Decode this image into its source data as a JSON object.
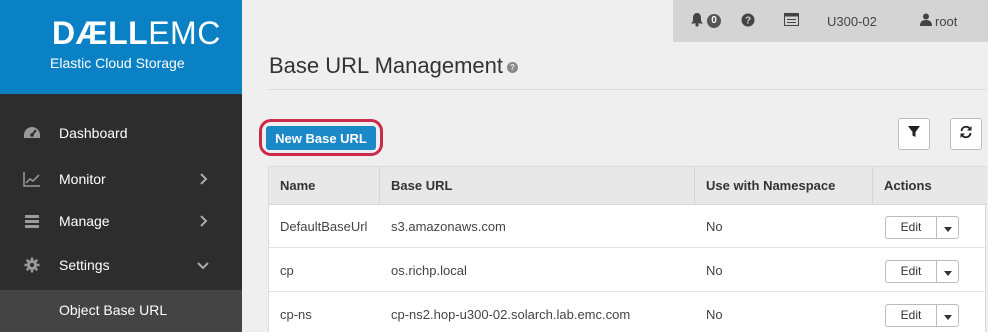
{
  "brand": {
    "logo_dell": "DÆLL",
    "logo_emc": "EMC",
    "product": "Elastic Cloud Storage"
  },
  "sidebar": {
    "items": [
      {
        "label": "Dashboard",
        "icon": "dashboard-icon"
      },
      {
        "label": "Monitor",
        "icon": "chart-line-icon",
        "chevron": "right"
      },
      {
        "label": "Manage",
        "icon": "server-icon",
        "chevron": "right"
      },
      {
        "label": "Settings",
        "icon": "gear-icon",
        "chevron": "down"
      }
    ],
    "active_sub": "Object Base URL"
  },
  "topbar": {
    "alerts_count": "0",
    "vdc": "U300-02",
    "user": "root"
  },
  "page": {
    "title": "Base URL Management",
    "new_button": "New Base URL"
  },
  "table": {
    "columns": [
      "Name",
      "Base URL",
      "Use with Namespace",
      "Actions"
    ],
    "rows": [
      {
        "name": "DefaultBaseUrl",
        "base_url": "s3.amazonaws.com",
        "namespace": "No",
        "action": "Edit"
      },
      {
        "name": "cp",
        "base_url": "os.richp.local",
        "namespace": "No",
        "action": "Edit"
      },
      {
        "name": "cp-ns",
        "base_url": "cp-ns2.hop-u300-02.solarch.lab.emc.com",
        "namespace": "No",
        "action": "Edit"
      }
    ]
  },
  "colors": {
    "brand_blue": "#0a80c5",
    "sidebar_bg": "#2d2d2d",
    "primary_button": "#1b88c8",
    "highlight_ring": "#cc2a4c"
  }
}
